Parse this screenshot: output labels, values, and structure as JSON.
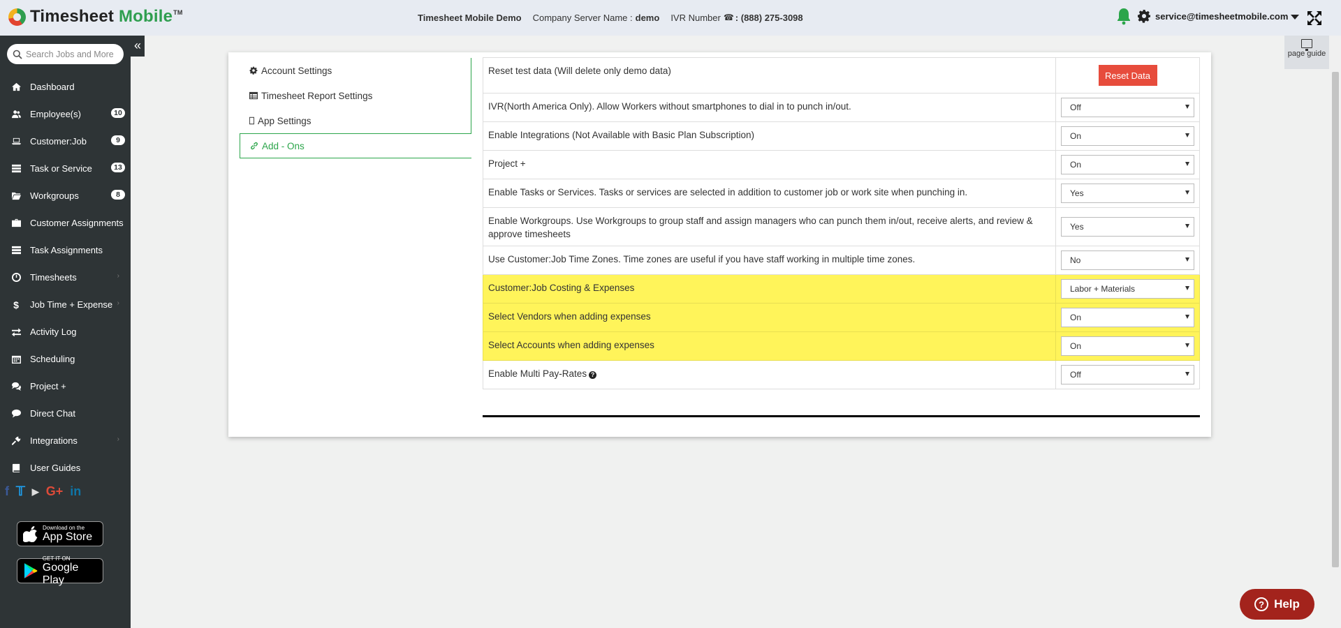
{
  "header": {
    "app_name_part1": "Timesheet",
    "app_name_part2": "Mobile",
    "tm": "TM",
    "demo_name": "Timesheet Mobile Demo",
    "server_label": "Company Server Name :",
    "server_value": "demo",
    "ivr_label": "IVR Number",
    "ivr_value": ": (888) 275-3098",
    "user_email": "service@timesheetmobile.com"
  },
  "page_guide": {
    "label": "page guide"
  },
  "sidebar": {
    "search_placeholder": "Search Jobs and More",
    "items": [
      {
        "label": "Dashboard",
        "icon": "home-icon"
      },
      {
        "label": "Employee(s)",
        "icon": "users-icon",
        "badge": "10"
      },
      {
        "label": "Customer:Job",
        "icon": "laptop-icon",
        "badge": "9"
      },
      {
        "label": "Task or Service",
        "icon": "list-icon",
        "badge": "13"
      },
      {
        "label": "Workgroups",
        "icon": "folder-icon",
        "badge": "8"
      },
      {
        "label": "Customer Assignments",
        "icon": "briefcase-icon"
      },
      {
        "label": "Task Assignments",
        "icon": "list-icon"
      },
      {
        "label": "Timesheets",
        "icon": "clock-icon",
        "chevron": true
      },
      {
        "label": "Job Time + Expense",
        "icon": "dollar-icon",
        "chevron": true
      },
      {
        "label": "Activity Log",
        "icon": "exchange-icon"
      },
      {
        "label": "Scheduling",
        "icon": "calendar-icon"
      },
      {
        "label": "Project +",
        "icon": "comments-icon"
      },
      {
        "label": "Direct Chat",
        "icon": "comment-icon"
      },
      {
        "label": "Integrations",
        "icon": "plug-icon",
        "chevron": true
      },
      {
        "label": "User Guides",
        "icon": "book-icon"
      }
    ],
    "app_store": {
      "small": "Download on the",
      "big": "App Store"
    },
    "google_play": {
      "small": "GET IT ON",
      "big": "Google Play"
    }
  },
  "settings_nav": {
    "items": [
      {
        "label": "Account Settings",
        "icon": "gear-icon"
      },
      {
        "label": "Timesheet Report Settings",
        "icon": "table-icon"
      },
      {
        "label": "App Settings",
        "icon": "mobile-icon"
      },
      {
        "label": "Add - Ons",
        "icon": "link-icon",
        "active": true
      }
    ]
  },
  "settings": {
    "reset": {
      "label": "Reset test data (Will delete only demo data)",
      "button": "Reset Data"
    },
    "rows": [
      {
        "label": "IVR(North America Only). Allow Workers without smartphones to dial in to punch in/out.",
        "value": "Off"
      },
      {
        "label": "Enable Integrations (Not Available with Basic Plan Subscription)",
        "value": "On"
      },
      {
        "label": "Project +",
        "value": "On"
      },
      {
        "label": "Enable Tasks or Services. Tasks or services are selected in addition to customer job or work site when punching in.",
        "value": "Yes"
      },
      {
        "label": "Enable Workgroups. Use Workgroups to group staff and assign managers who can punch them in/out, receive alerts, and review & approve timesheets",
        "value": "Yes"
      },
      {
        "label": "Use Customer:Job Time Zones. Time zones are useful if you have staff working in multiple time zones.",
        "value": "No"
      },
      {
        "label": "Customer:Job Costing & Expenses",
        "value": "Labor + Materials",
        "highlight": true
      },
      {
        "label": "Select Vendors when adding expenses",
        "value": "On",
        "highlight": true
      },
      {
        "label": "Select Accounts when adding expenses",
        "value": "On",
        "highlight": true
      },
      {
        "label": "Enable Multi Pay-Rates",
        "value": "Off",
        "help": true
      }
    ]
  },
  "help_button": {
    "label": "Help"
  },
  "colors": {
    "accent_green": "#2ba54a",
    "highlight": "#fff45a",
    "reset_red": "#e74c3c",
    "help_red": "#a3231c",
    "sidebar": "#2e3436"
  }
}
